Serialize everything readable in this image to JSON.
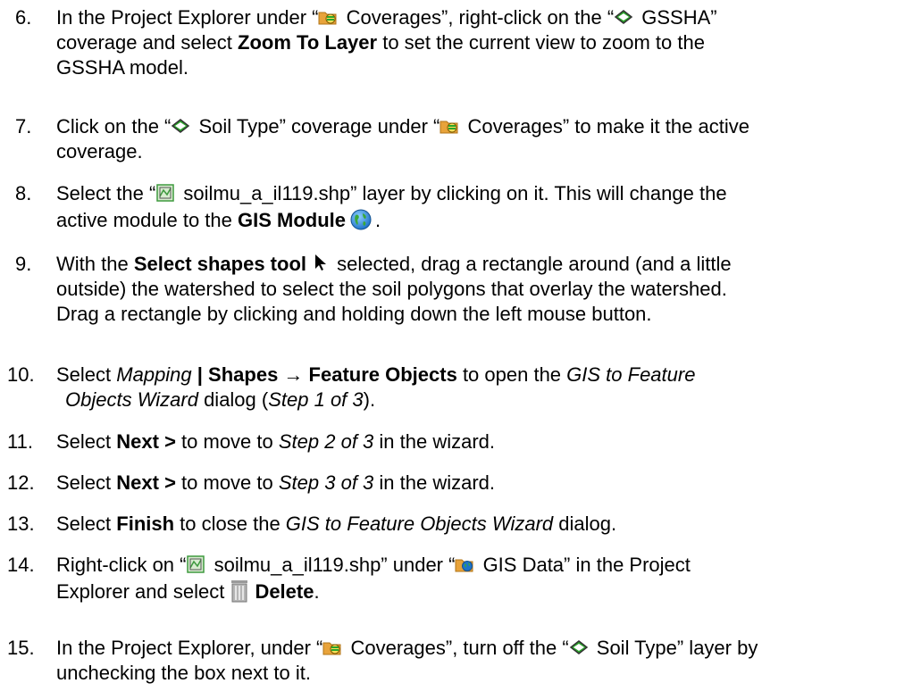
{
  "steps": [
    {
      "num": "6.",
      "t1": "In the Project Explorer under “",
      "t2": " Coverages”, right-click on the “",
      "t3": " GSSHA”",
      "l2a": "coverage and select ",
      "l2b": "Zoom To Layer",
      "l2c": " to set the current view to zoom to the",
      "l3": "GSSHA model."
    },
    {
      "num": "7.",
      "t1": "Click on the “",
      "t2": " Soil Type” coverage under “",
      "t3": " Coverages” to make it the active",
      "l2": "coverage."
    },
    {
      "num": "8.",
      "t1": "Select the “",
      "t2": " soilmu_a_il119.shp” layer by clicking on it.  This will change the",
      "l2a": "active module to the ",
      "l2b": "GIS Module",
      "l2c": "."
    },
    {
      "num": "9.",
      "t1": "With the ",
      "t2": "Select shapes tool",
      "t3": " selected, drag a rectangle around (and a little",
      "l2": "outside) the watershed to select the soil polygons that overlay the watershed.",
      "l3": "Drag a rectangle by clicking and holding down the left mouse button."
    },
    {
      "num": "10.",
      "t1": "Select ",
      "t2": "Mapping",
      "t3": " | ",
      "t4": "Shapes",
      "t5": " → ",
      "t6": "Feature Objects",
      "t7": " to open the ",
      "t8": "GIS to Feature",
      "l2a": "Objects Wizard",
      "l2b": " dialog (",
      "l2c": "Step 1 of 3",
      "l2d": ")."
    },
    {
      "num": "11.",
      "t1": "Select ",
      "t2": "Next >",
      "t3": " to move to ",
      "t4": "Step 2 of 3",
      "t5": " in the wizard."
    },
    {
      "num": "12.",
      "t1": "Select ",
      "t2": "Next >",
      "t3": " to move to ",
      "t4": "Step 3 of 3",
      "t5": " in the wizard."
    },
    {
      "num": "13.",
      "t1": "Select ",
      "t2": "Finish",
      "t3": " to close the ",
      "t4": "GIS to Feature Objects Wizard",
      "t5": " dialog."
    },
    {
      "num": "14.",
      "t1": "Right-click on “",
      "t2": " soilmu_a_il119.shp” under “",
      "t3": " GIS Data” in the Project",
      "l2a": "Explorer and select ",
      "l2b": "Delete",
      "l2c": "."
    },
    {
      "num": "15.",
      "t1": "In the Project Explorer, under “",
      "t2": " Coverages”, turn off the “",
      "t3": " Soil Type” layer by",
      "l2": "unchecking the box next to it."
    }
  ],
  "icons": {
    "coverages": "coverages-folder-icon",
    "coverage": "coverage-icon",
    "shapefile": "shapefile-icon",
    "gis_module": "gis-module-globe-icon",
    "select_tool": "select-shapes-arrow-icon",
    "gis_data": "gis-data-folder-icon",
    "delete": "trash-can-icon"
  },
  "colors": {
    "folder": "#e8a33a",
    "coverage_green": "#2aa52a",
    "globe": "#1f74c9",
    "shapefile_green": "#3f9a3f"
  }
}
